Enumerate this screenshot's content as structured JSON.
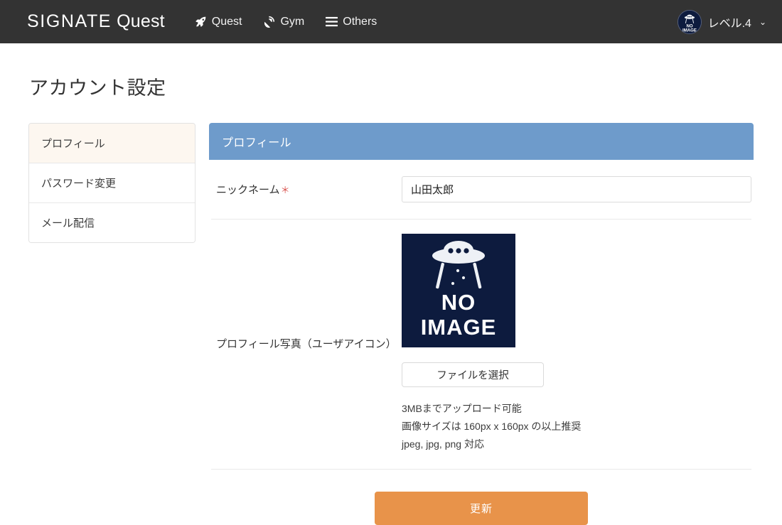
{
  "header": {
    "brand_primary": "SIGNATE",
    "brand_secondary": "Quest",
    "nav": [
      {
        "label": "Quest",
        "icon": "rocket-icon"
      },
      {
        "label": "Gym",
        "icon": "satellite-dish-icon"
      },
      {
        "label": "Others",
        "icon": "hamburger-icon"
      }
    ],
    "user_level": "レベル.4",
    "caret": "⌄",
    "avatar_alt": "NO IMAGE",
    "bg_color": "#333333"
  },
  "page": {
    "title": "アカウント設定"
  },
  "sidebar": {
    "items": [
      {
        "label": "プロフィール",
        "active": true
      },
      {
        "label": "パスワード変更",
        "active": false
      },
      {
        "label": "メール配信",
        "active": false
      }
    ],
    "active_bg": "#fdf7f0"
  },
  "panel": {
    "title": "プロフィール",
    "header_color": "#6e9bcb",
    "fields": {
      "nickname": {
        "label": "ニックネーム",
        "required_mark": "＊",
        "value": "山田太郎",
        "placeholder": ""
      },
      "photo": {
        "label": "プロフィール写真（ユーザアイコン）",
        "thumbnail_text_line1": "NO",
        "thumbnail_text_line2": "IMAGE",
        "thumbnail_bg": "#0d1b3e",
        "file_button_label": "ファイルを選択",
        "hints": [
          "3MBまでアップロード可能",
          "画像サイズは 160px x 160px の以上推奨",
          "jpeg, jpg, png 対応"
        ]
      }
    },
    "submit_label": "更新",
    "submit_color": "#e8934a"
  }
}
